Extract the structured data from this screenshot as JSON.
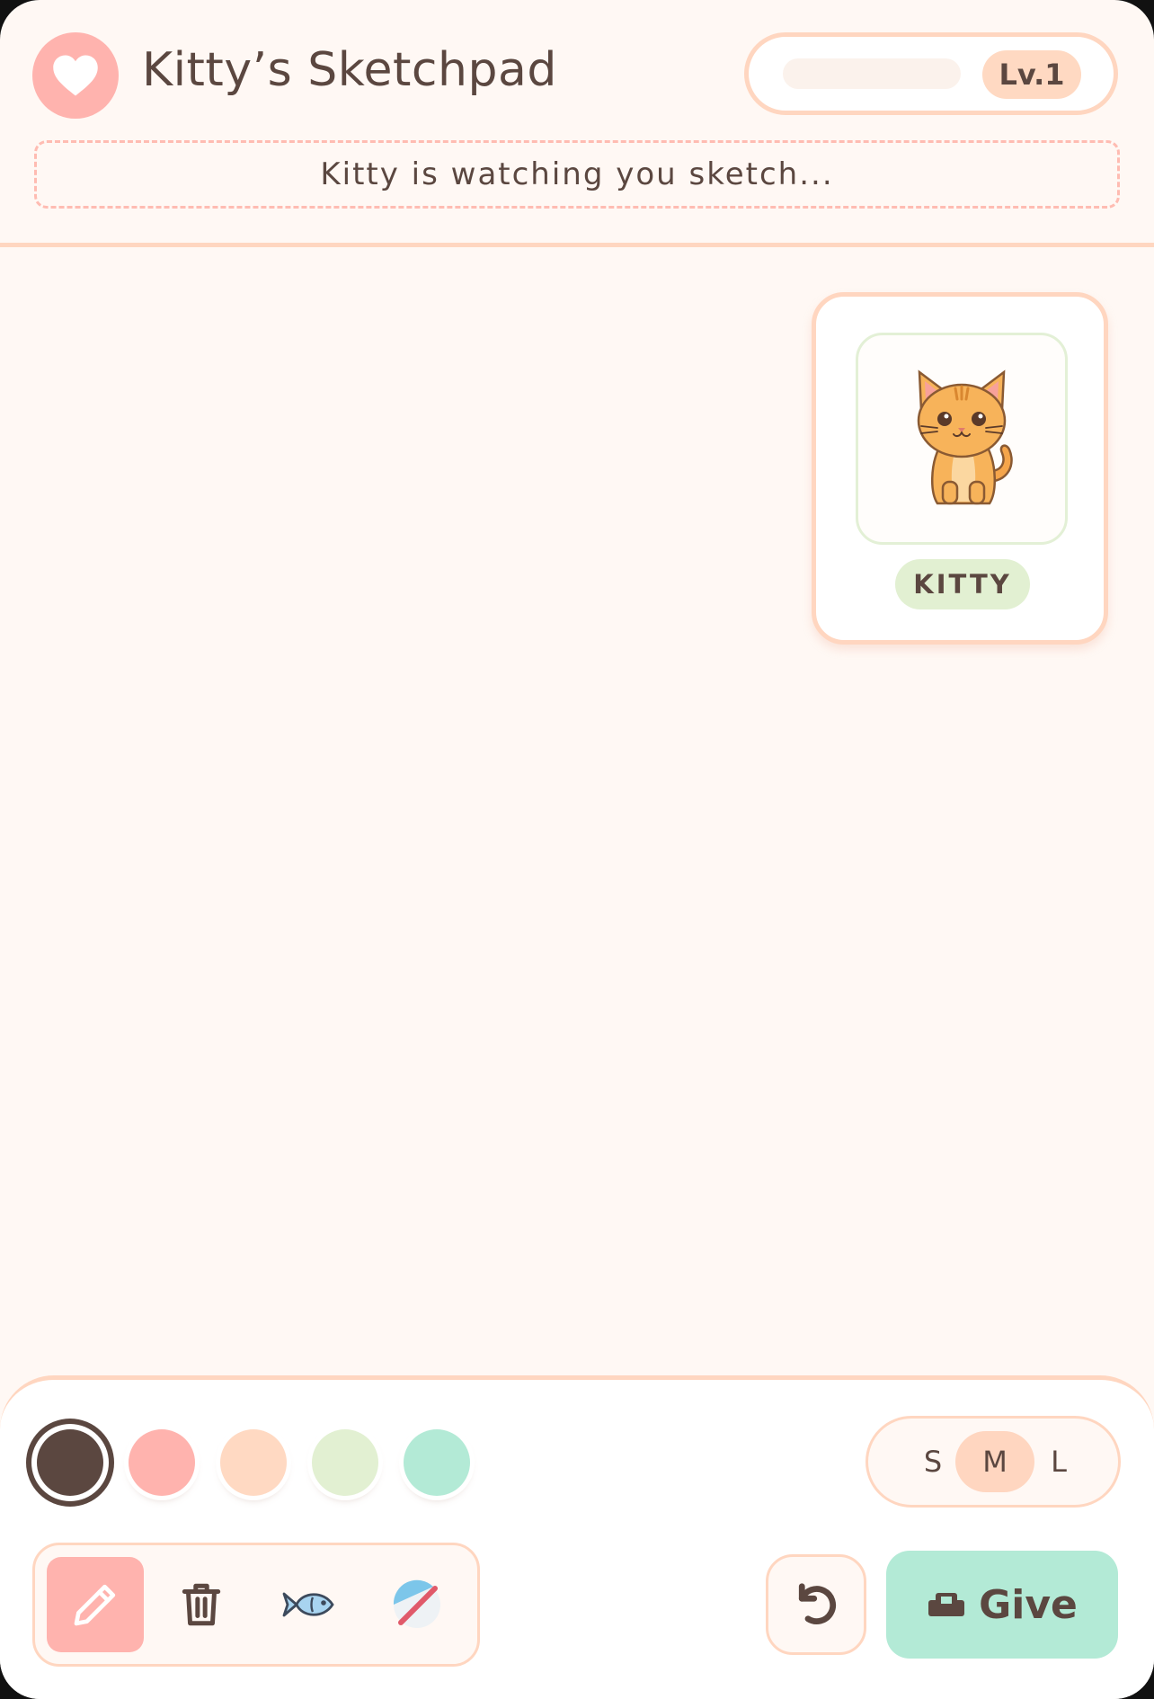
{
  "header": {
    "title": "Kitty’s Sketchpad",
    "logo_icon": "heart-icon",
    "level_label": "Lv.1",
    "progress": 0,
    "status_text": "Kitty is watching you sketch..."
  },
  "pet": {
    "name": "KITTY",
    "image_icon": "cat-icon"
  },
  "palette": {
    "colors": [
      "#5b4740",
      "#ffb3ae",
      "#ffd9c2",
      "#e2f0d2",
      "#b3ead6"
    ],
    "selected_index": 0
  },
  "brush_sizes": {
    "options": [
      "S",
      "M",
      "L"
    ],
    "selected": "M"
  },
  "tools": [
    {
      "icon": "pencil-icon",
      "active": true
    },
    {
      "icon": "trash-icon",
      "active": false
    },
    {
      "icon": "fish-icon",
      "active": false
    },
    {
      "icon": "yarn-ball-icon",
      "active": false
    }
  ],
  "actions": {
    "undo_icon": "undo-icon",
    "give_label": "Give",
    "give_icon": "gift-icon"
  }
}
